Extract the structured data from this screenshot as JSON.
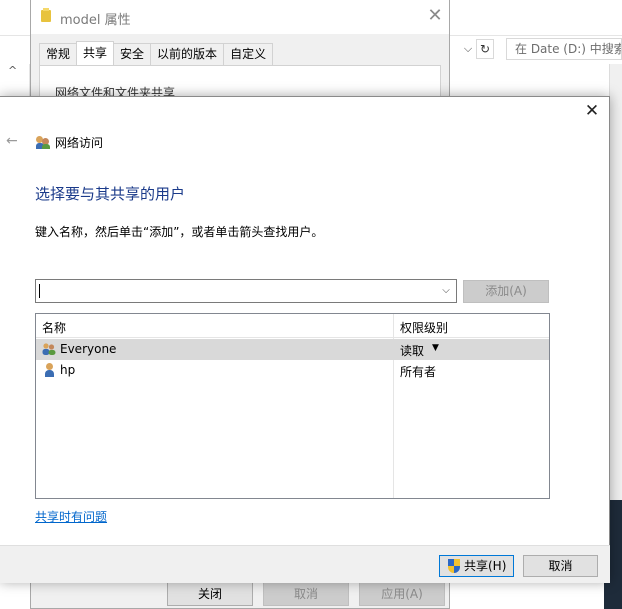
{
  "explorer": {
    "search_placeholder": "在 Date (D:) 中搜索",
    "address_dropdown_glyph": "⌵",
    "refresh_glyph": "↻"
  },
  "properties_dialog": {
    "title": "model 属性",
    "tabs": [
      {
        "label": "常规",
        "active": false
      },
      {
        "label": "共享",
        "active": true
      },
      {
        "label": "安全",
        "active": false
      },
      {
        "label": "以前的版本",
        "active": false
      },
      {
        "label": "自定义",
        "active": false
      }
    ],
    "groupbox_label": "网络文件和文件夹共享",
    "buttons": {
      "close": "关闭",
      "cancel": "取消",
      "apply": "应用(A)"
    }
  },
  "share_dialog": {
    "window_title": "网络访问",
    "heading": "选择要与其共享的用户",
    "instruction": "键入名称，然后单击“添加”，或者单击箭头查找用户。",
    "input": {
      "value": "",
      "placeholder": ""
    },
    "add_button": "添加(A)",
    "columns": {
      "name": "名称",
      "permission": "权限级别"
    },
    "rows": [
      {
        "name": "Everyone",
        "permission": "读取",
        "selected": true,
        "icon": "user-group-icon"
      },
      {
        "name": "hp",
        "permission": "所有者",
        "selected": false,
        "icon": "user-icon"
      }
    ],
    "help_link": "共享时有问题",
    "share_button": "共享(H)",
    "cancel_button": "取消"
  },
  "colors": {
    "heading_blue": "#1a3a8a",
    "link_blue": "#0066cc",
    "selection_gray": "#d9d9d9",
    "focus_blue": "#0078d7"
  }
}
